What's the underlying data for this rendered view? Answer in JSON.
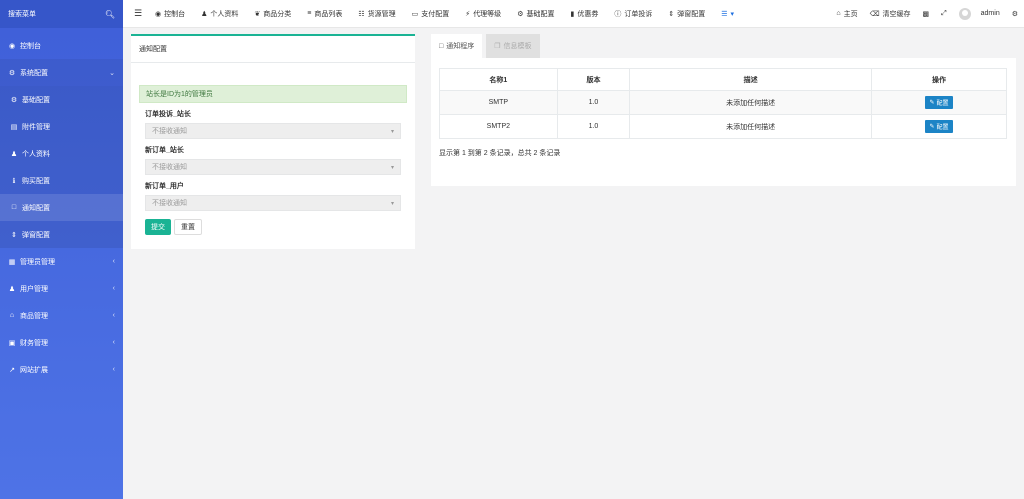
{
  "sidebar": {
    "search_placeholder": "搜索菜单",
    "dashboard": "控制台",
    "system_config": "系统配置",
    "submenu": [
      "基础配置",
      "附件管理",
      "个人资料",
      "购买配置",
      "通知配置",
      "弹窗配置"
    ],
    "groups": [
      "管理员管理",
      "用户管理",
      "商品管理",
      "财务管理",
      "网站扩展"
    ]
  },
  "topbar": {
    "items": [
      "控制台",
      "个人资料",
      "商品分类",
      "商品列表",
      "货源管理",
      "支付配置",
      "代理等级",
      "基础配置",
      "优惠券",
      "订单投诉",
      "弹窗配置"
    ],
    "home": "主页",
    "clear_cache": "清空缓存",
    "user": "admin"
  },
  "left_panel": {
    "title": "通知配置",
    "alert": "站长是ID为1的管理员",
    "fields": [
      {
        "label": "订单投诉_站长",
        "value": "不接收通知"
      },
      {
        "label": "新订单_站长",
        "value": "不接收通知"
      },
      {
        "label": "新订单_用户",
        "value": "不接收通知"
      }
    ],
    "submit": "提交",
    "reset": "重置"
  },
  "right_panel": {
    "tabs": [
      "通知程序",
      "信息模板"
    ],
    "columns": [
      "名称1",
      "版本",
      "描述",
      "操作"
    ],
    "rows": [
      {
        "name": "SMTP",
        "version": "1.0",
        "desc": "未添加任何描述",
        "action": "配置"
      },
      {
        "name": "SMTP2",
        "version": "1.0",
        "desc": "未添加任何描述",
        "action": "配置"
      }
    ],
    "pager": "显示第 1 到第 2 条记录，总共 2 条记录"
  },
  "colors": {
    "sidebar": "#4a6fe0",
    "accent": "#1ab394",
    "config_button": "#1c84c6"
  }
}
